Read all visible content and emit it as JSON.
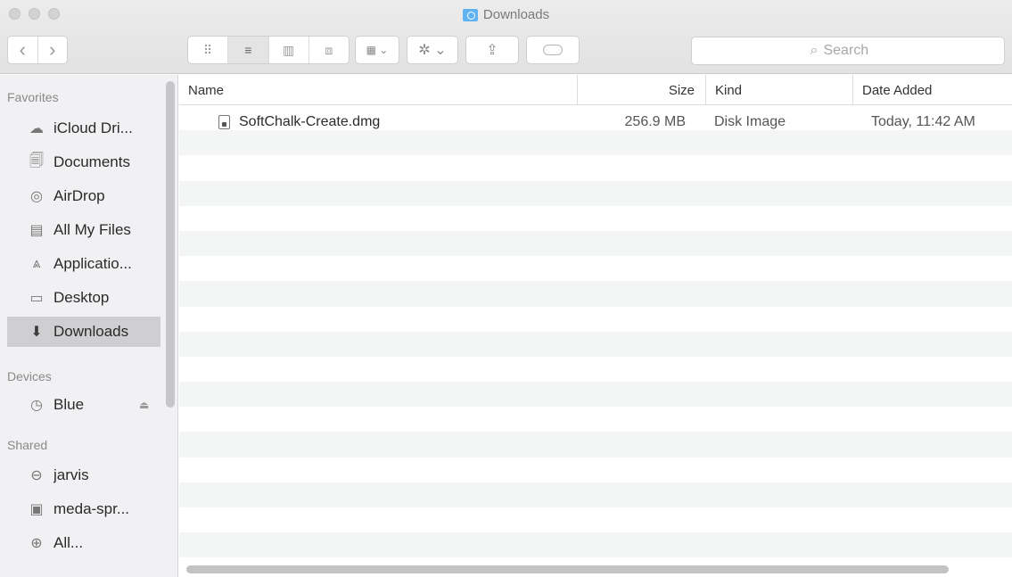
{
  "window": {
    "title": "Downloads"
  },
  "toolbar": {
    "back_glyph": "‹",
    "forward_glyph": "›",
    "views": [
      {
        "name": "icon-view",
        "glyph": "⠿"
      },
      {
        "name": "list-view",
        "glyph": "≡"
      },
      {
        "name": "column-view",
        "glyph": "▥"
      },
      {
        "name": "coverflow-view",
        "glyph": "⧈"
      }
    ],
    "arrange_glyph": "▦ ⌄",
    "action_glyph": "✲ ⌄",
    "share_glyph": "⇪"
  },
  "search": {
    "placeholder": "Search",
    "glyph": "⌕"
  },
  "sidebar": {
    "favorites_title": "Favorites",
    "favorites": [
      {
        "label": "iCloud Dri...",
        "icon": "cloud-icon",
        "glyph": "☁"
      },
      {
        "label": "Documents",
        "icon": "documents-icon",
        "glyph": "🗐"
      },
      {
        "label": "AirDrop",
        "icon": "airdrop-icon",
        "glyph": "◎"
      },
      {
        "label": "All My Files",
        "icon": "all-files-icon",
        "glyph": "▤"
      },
      {
        "label": "Applicatio...",
        "icon": "applications-icon",
        "glyph": "⩓"
      },
      {
        "label": "Desktop",
        "icon": "desktop-icon",
        "glyph": "▭"
      },
      {
        "label": "Downloads",
        "icon": "downloads-icon",
        "glyph": "⬇"
      }
    ],
    "devices_title": "Devices",
    "devices": [
      {
        "label": "Blue",
        "icon": "time-machine-disk-icon",
        "glyph": "◷",
        "eject_glyph": "⏏"
      }
    ],
    "shared_title": "Shared",
    "shared": [
      {
        "label": "jarvis",
        "icon": "server-icon",
        "glyph": "⊖"
      },
      {
        "label": "meda-spr...",
        "icon": "computer-icon",
        "glyph": "▣"
      },
      {
        "label": "All...",
        "icon": "network-icon",
        "glyph": "⊕"
      }
    ]
  },
  "list": {
    "columns": {
      "name": "Name",
      "size": "Size",
      "kind": "Kind",
      "date_added": "Date Added"
    },
    "rows": [
      {
        "name": "SoftChalk-Create.dmg",
        "size": "256.9 MB",
        "kind": "Disk Image",
        "date_added": "Today, 11:42 AM"
      }
    ]
  }
}
